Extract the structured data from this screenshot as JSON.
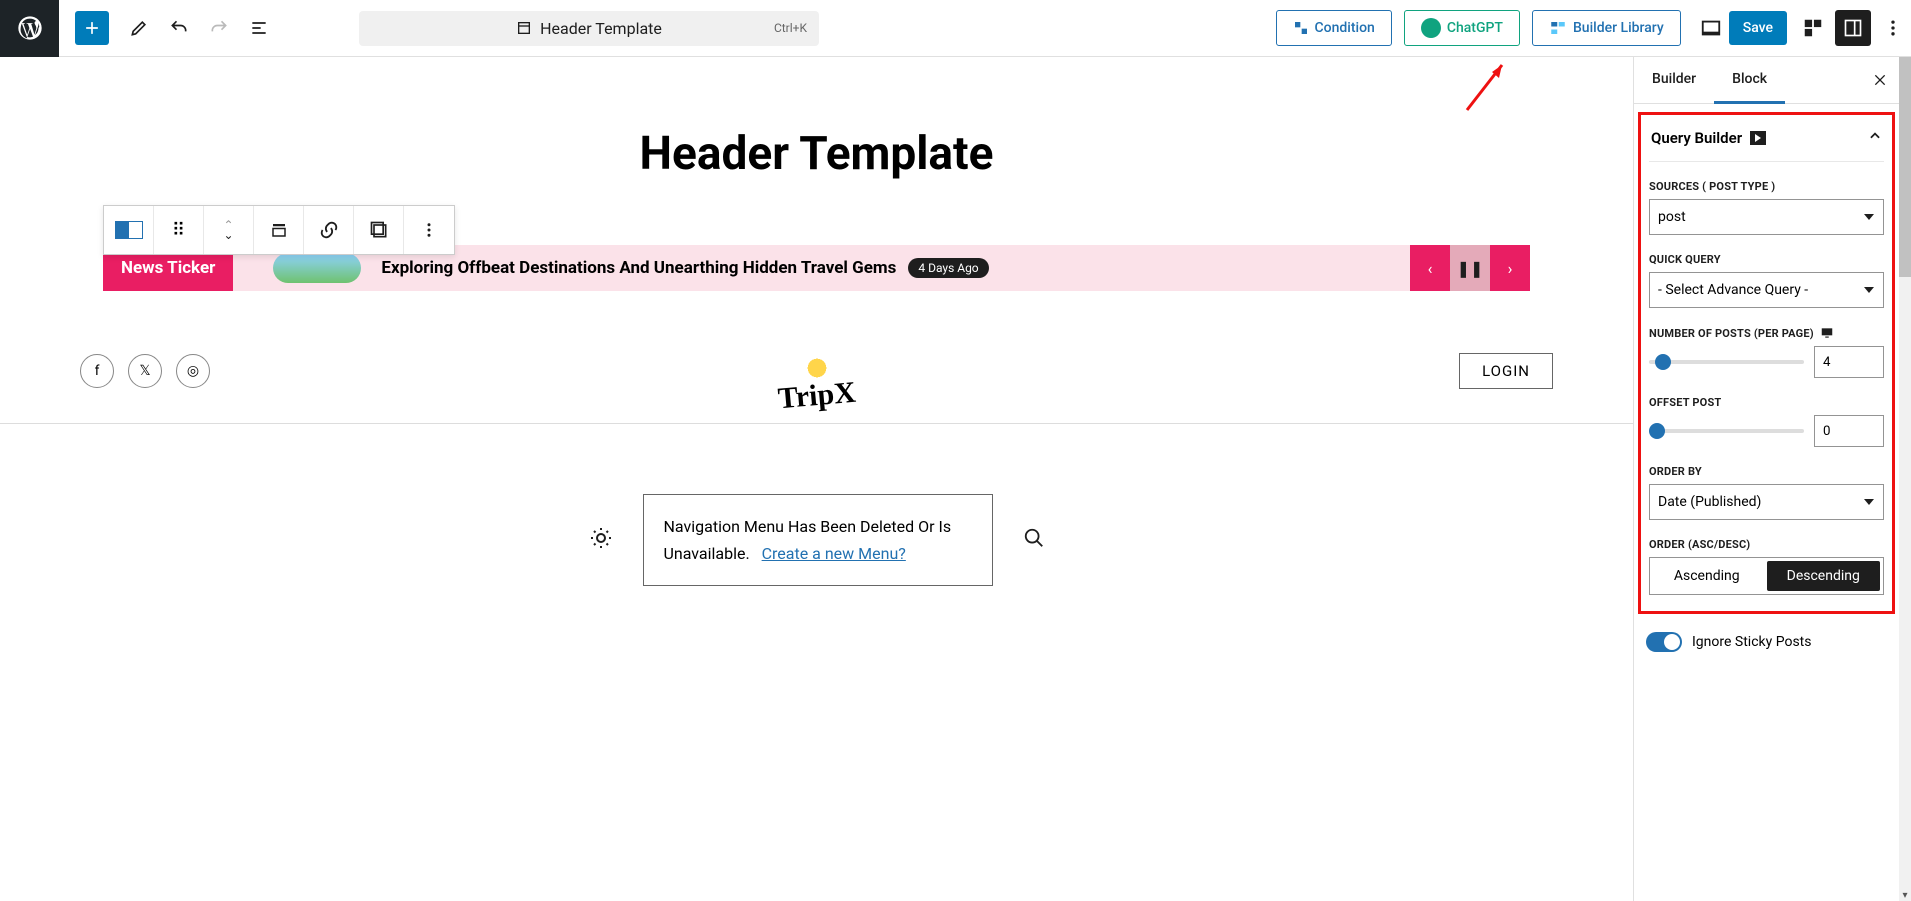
{
  "topbar": {
    "template_name": "Header Template",
    "shortcut": "Ctrl+K",
    "condition": "Condition",
    "chatgpt": "ChatGPT",
    "library": "Builder Library",
    "save": "Save"
  },
  "canvas": {
    "page_title": "Header Template",
    "news_ticker": {
      "label": "News Ticker",
      "headline": "Exploring Offbeat Destinations And Unearthing Hidden Travel Gems",
      "age_badge": "4 Days Ago"
    },
    "logo_text": "TripX",
    "login": "LOGIN",
    "nav_msg": "Navigation Menu Has Been Deleted Or Is Unavailable.",
    "nav_link": "Create a new Menu?"
  },
  "sidebar": {
    "tabs": {
      "builder": "Builder",
      "block": "Block"
    },
    "panel_title": "Query Builder",
    "sources_label": "SOURCES ( POST TYPE )",
    "sources_value": "post",
    "quick_label": "QUICK QUERY",
    "quick_value": "- Select Advance Query -",
    "num_label": "NUMBER OF POSTS (PER PAGE)",
    "num_value": "4",
    "offset_label": "OFFSET POST",
    "offset_value": "0",
    "orderby_label": "ORDER BY",
    "orderby_value": "Date (Published)",
    "order_label": "ORDER (ASC/DESC)",
    "asc": "Ascending",
    "desc": "Descending",
    "ignore": "Ignore Sticky Posts"
  }
}
